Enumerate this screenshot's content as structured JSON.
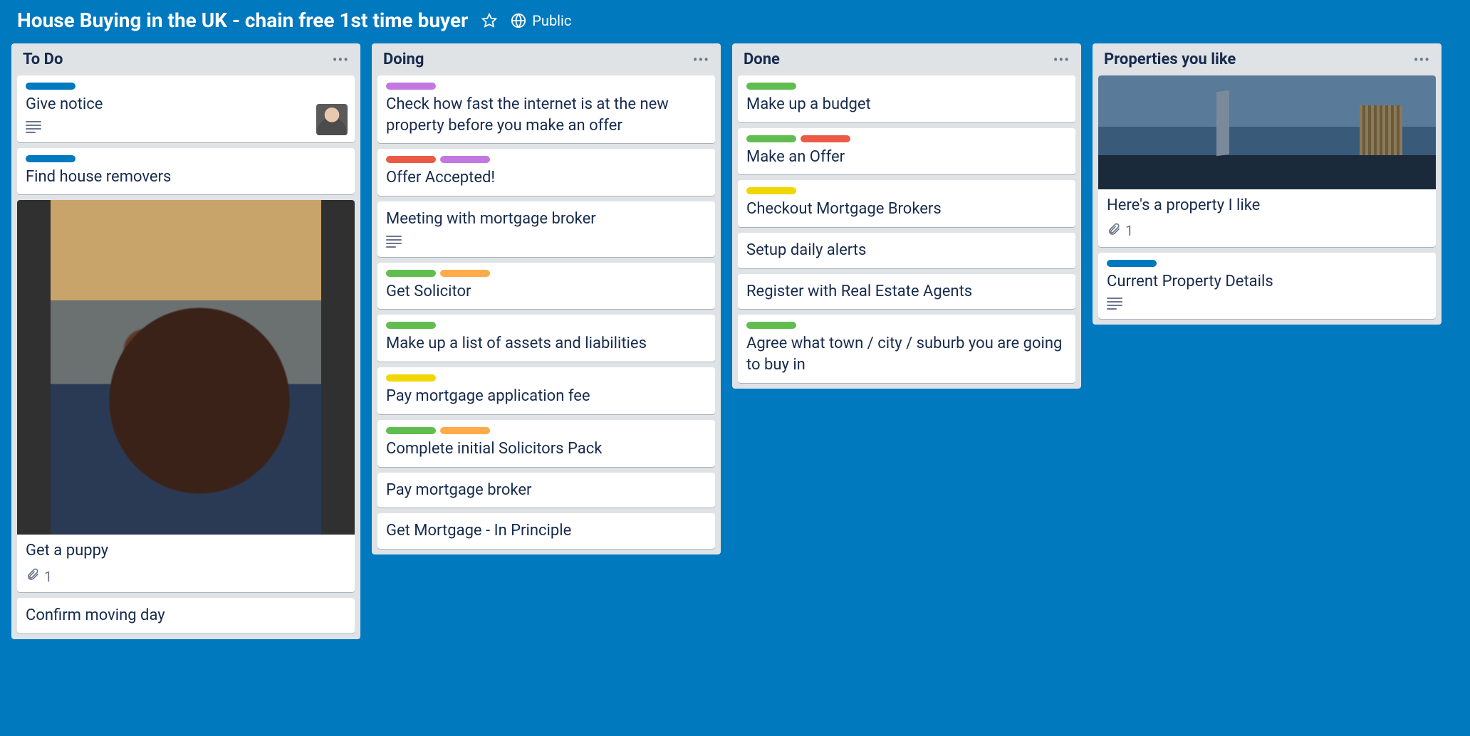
{
  "board": {
    "title": "House Buying in the UK - chain free 1st time buyer",
    "visibility": "Public"
  },
  "colors": {
    "blue": "#0079bf",
    "green": "#61bd4f",
    "purple": "#c377e0",
    "red": "#eb5a46",
    "orange": "#ffab4a",
    "yellow": "#f2d600"
  },
  "lists": [
    {
      "title": "To Do",
      "cards": [
        {
          "labels": [
            "blue"
          ],
          "title": "Give notice",
          "hasDescription": true,
          "hasAvatar": true
        },
        {
          "labels": [
            "blue"
          ],
          "title": "Find house removers"
        },
        {
          "cover": "puppy",
          "title": "Get a puppy",
          "attachments": 1
        },
        {
          "title": "Confirm moving day"
        }
      ]
    },
    {
      "title": "Doing",
      "cards": [
        {
          "labels": [
            "purple"
          ],
          "title": "Check how fast the internet is at the new property before you make an offer"
        },
        {
          "labels": [
            "red",
            "purple"
          ],
          "title": "Offer Accepted!"
        },
        {
          "title": "Meeting with mortgage broker",
          "hasDescription": true
        },
        {
          "labels": [
            "green",
            "orange"
          ],
          "title": "Get Solicitor"
        },
        {
          "labels": [
            "green"
          ],
          "title": "Make up a list of assets and liabilities"
        },
        {
          "labels": [
            "yellow"
          ],
          "title": "Pay mortgage application fee"
        },
        {
          "labels": [
            "green",
            "orange"
          ],
          "title": "Complete initial Solicitors Pack"
        },
        {
          "title": "Pay mortgage broker"
        },
        {
          "title": "Get Mortgage - In Principle"
        }
      ]
    },
    {
      "title": "Done",
      "cards": [
        {
          "labels": [
            "green"
          ],
          "title": "Make up a budget"
        },
        {
          "labels": [
            "green",
            "red"
          ],
          "title": "Make an Offer"
        },
        {
          "labels": [
            "yellow"
          ],
          "title": "Checkout Mortgage Brokers"
        },
        {
          "title": "Setup daily alerts"
        },
        {
          "title": "Register with Real Estate Agents"
        },
        {
          "labels": [
            "green"
          ],
          "title": "Agree what town / city / suburb you are going to buy in"
        }
      ]
    },
    {
      "title": "Properties you like",
      "cards": [
        {
          "cover": "city",
          "title": "Here's a property I like",
          "attachments": 1
        },
        {
          "labels": [
            "blue"
          ],
          "title": "Current Property Details",
          "hasDescription": true
        }
      ]
    }
  ]
}
